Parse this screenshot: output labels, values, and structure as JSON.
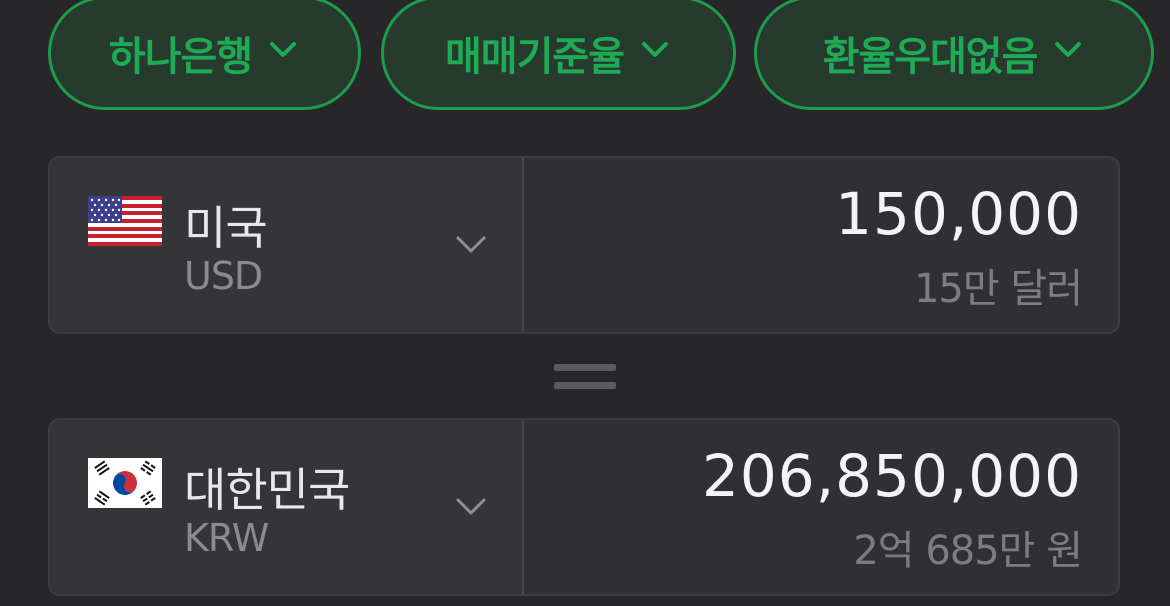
{
  "filters": {
    "bank": "하나은행",
    "rate_type": "매매기준율",
    "discount": "환율우대없음"
  },
  "from": {
    "flag_icon": "us-flag-icon",
    "country": "미국",
    "code": "USD",
    "amount": "150,000",
    "amount_words": "15만 달러"
  },
  "to": {
    "flag_icon": "kr-flag-icon",
    "country": "대한민국",
    "code": "KRW",
    "amount": "206,850,000",
    "amount_words": "2억 685만 원"
  },
  "colors": {
    "accent": "#1faa55",
    "background": "#27272a"
  }
}
